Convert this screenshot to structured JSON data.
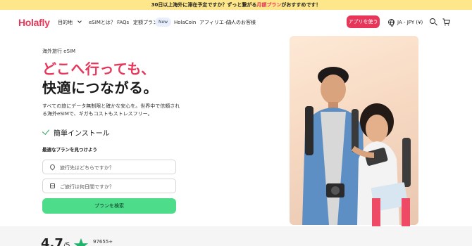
{
  "banner": {
    "text_before": "30日以上海外に滞在予定ですか？ずっと繋がる",
    "highlight": "月額プラン",
    "text_after": "がおすすめです！"
  },
  "nav": {
    "logo": "Holafly",
    "items": [
      "目的地",
      "eSIMとは？",
      "FAQs",
      "定額プラン",
      "HolaCoin",
      "アフィリエイト",
      "法人のお客様"
    ],
    "new_badge": "New",
    "cta": "アプリを使う",
    "language": "JA - JPY (¥)"
  },
  "hero": {
    "eyebrow": "海外旅行 eSIM",
    "headline_line1": "どこへ行っても、",
    "headline_line2": "快適につながる。",
    "description": "すべての旅にデータ無制限と確かな安心を。世界中で信頼される海外eSIMで、ギガもコストもストレスフリー。",
    "feature": "簡単インストール",
    "find_plan": "最適なプランを見つけよう",
    "destination_placeholder": "旅行先はどちらですか？",
    "days_placeholder": "ご旅行は何日間ですか？",
    "search_button": "プランを検索"
  },
  "rating": {
    "score": "4.7",
    "out_of": "/5",
    "reviews": "97655+"
  },
  "colors": {
    "brand": "#e6375a",
    "banner": "#fde78a",
    "search_button": "#4ddc8a"
  }
}
